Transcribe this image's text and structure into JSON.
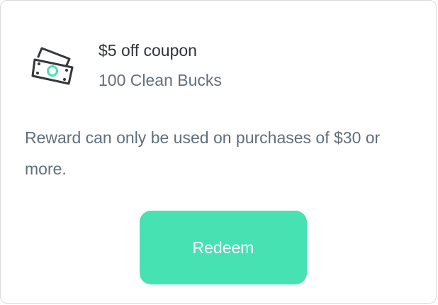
{
  "reward": {
    "icon": "cash-icon",
    "title": "$5 off coupon",
    "cost": "100 Clean Bucks",
    "description": "Reward can only be used on purchases of $30 or more.",
    "button_label": "Redeem"
  },
  "colors": {
    "accent": "#47e2b2",
    "title_text": "#2f3437",
    "secondary_text": "#62707c",
    "border": "#d7d9dc"
  }
}
